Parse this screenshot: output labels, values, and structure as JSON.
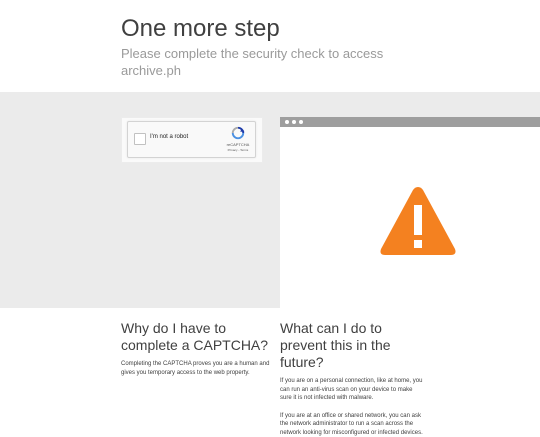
{
  "header": {
    "title": "One more step",
    "subtitle": "Please complete the security check to access archive.ph"
  },
  "captcha": {
    "label": "I'm not a robot",
    "brand": "reCAPTCHA",
    "privacy": "Privacy",
    "separator": "-",
    "terms": "Terms",
    "checked": false
  },
  "illustration": {
    "icon": "warning-icon",
    "warning_color": "#f48120"
  },
  "info": {
    "left": {
      "heading": "Why do I have to complete a CAPTCHA?",
      "body": "Completing the CAPTCHA proves you are a human and gives you temporary access to the web property."
    },
    "right": {
      "heading": "What can I do to prevent this in the future?",
      "body1": "If you are on a personal connection, like at home, you can run an anti-virus scan on your device to make sure it is not infected with malware.",
      "body2": "If you are at an office or shared network, you can ask the network administrator to run a scan across the network looking for misconfigured or infected devices."
    }
  }
}
